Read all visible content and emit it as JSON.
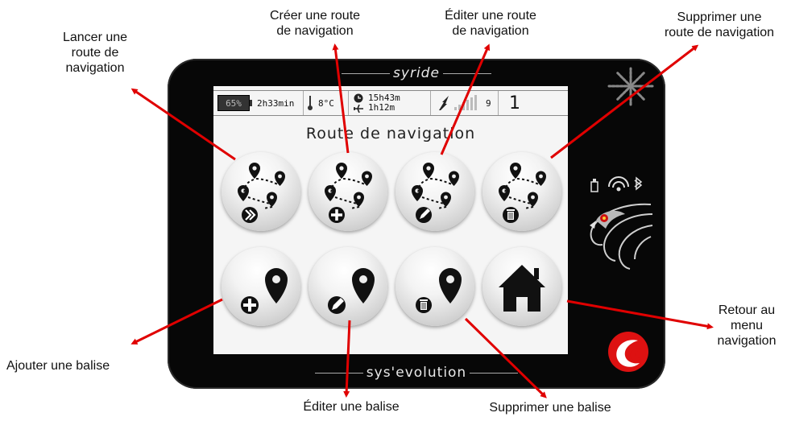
{
  "device": {
    "brand_top": "syride",
    "brand_bottom": "sys'evolution"
  },
  "status_bar": {
    "battery_percent": "65%",
    "battery_time": "2h33min",
    "temperature": "8°C",
    "clock_time": "15h43m",
    "flight_time": "1h12m",
    "satellites": "9",
    "page_number": "1"
  },
  "screen": {
    "title": "Route de navigation"
  },
  "callouts": {
    "launch_route": "Lancer une\nroute de\nnavigation",
    "create_route": "Créer une route\nde navigation",
    "edit_route": "Éditer une route\nde navigation",
    "delete_route": "Supprimer une\nroute de navigation",
    "add_beacon": "Ajouter une balise",
    "edit_beacon": "Éditer une balise",
    "delete_beacon": "Supprimer une balise",
    "back_menu": "Retour au\nmenu\nnavigation"
  },
  "colors": {
    "arrow": "#e00000",
    "device": "#070707",
    "screen": "#f5f5f5"
  }
}
